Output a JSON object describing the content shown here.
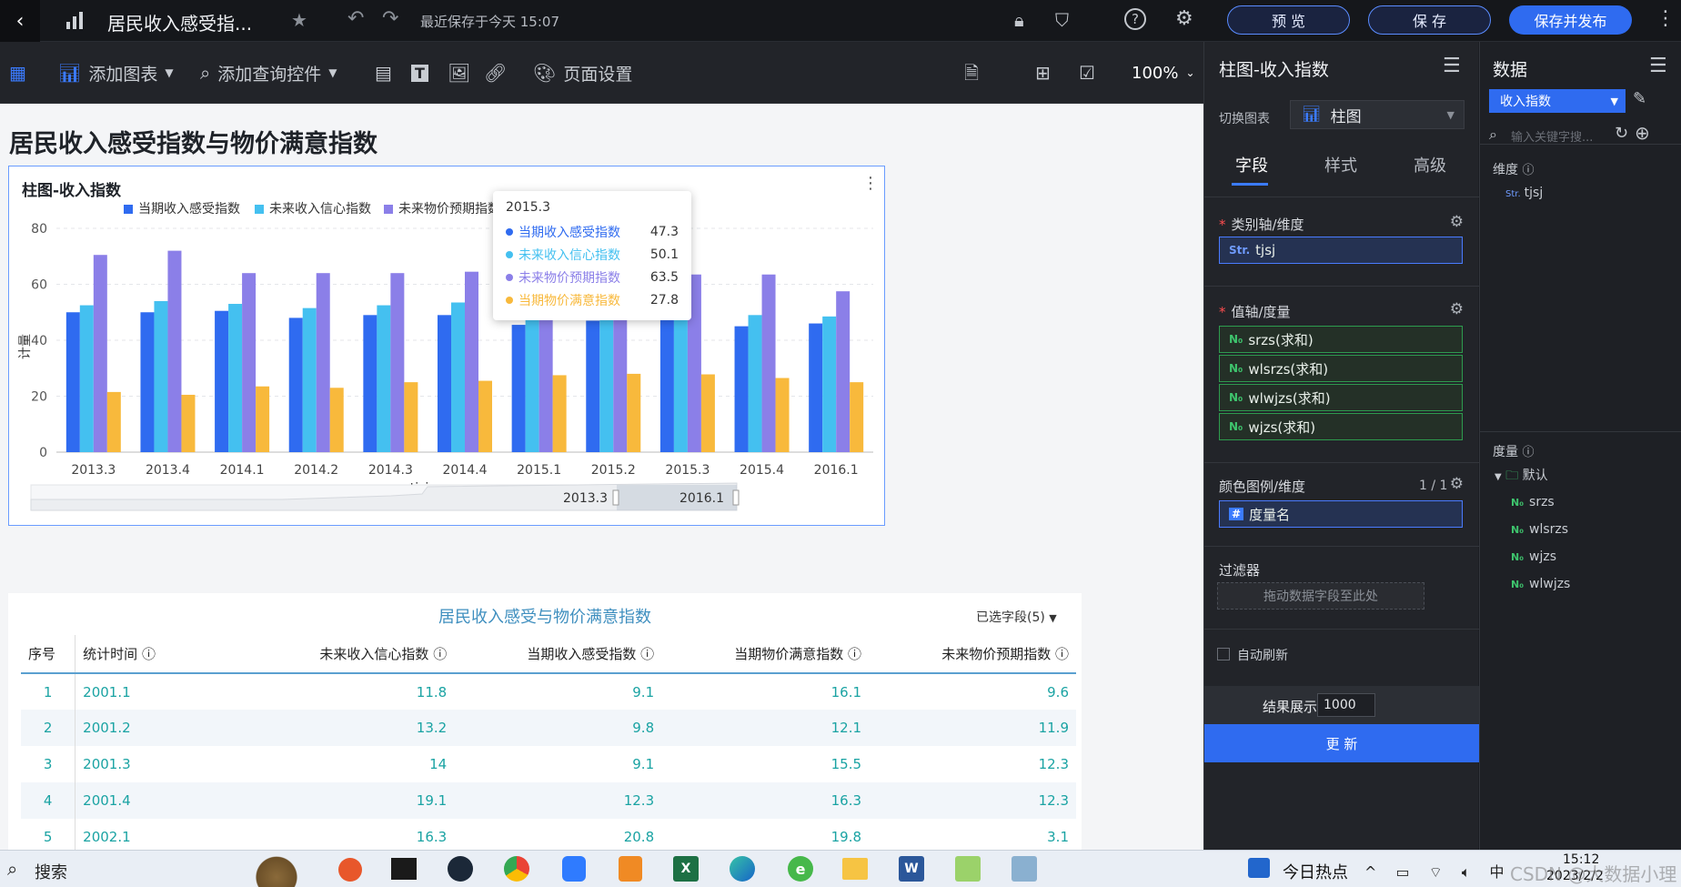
{
  "topbar": {
    "title": "居民收入感受指...",
    "save_status": "最近保存于今天 15:07",
    "preview": "预 览",
    "save": "保 存",
    "save_publish": "保存并发布"
  },
  "toolbar": {
    "add_chart": "添加图表",
    "add_query": "添加查询控件",
    "page_settings": "页面设置",
    "zoom": "100%"
  },
  "page": {
    "title": "居民收入感受指数与物价满意指数"
  },
  "chart_card": {
    "title": "柱图-收入指数",
    "x_axis_label": "tjsj",
    "y_axis_label": "计量",
    "slider_start": "2013.3",
    "slider_end": "2016.1"
  },
  "tooltip": {
    "title": "2015.3",
    "rows": [
      {
        "name": "当期收入感受指数",
        "value": "47.3",
        "color": "#2f6bf0"
      },
      {
        "name": "未来收入信心指数",
        "value": "50.1",
        "color": "#44c0f0"
      },
      {
        "name": "未来物价预期指数",
        "value": "63.5",
        "color": "#8b7fe8"
      },
      {
        "name": "当期物价满意指数",
        "value": "27.8",
        "color": "#f8b93c"
      }
    ]
  },
  "chart_data": {
    "type": "bar",
    "categories": [
      "2013.3",
      "2013.4",
      "2014.1",
      "2014.2",
      "2014.3",
      "2014.4",
      "2015.1",
      "2015.2",
      "2015.3",
      "2015.4",
      "2016.1"
    ],
    "series": [
      {
        "name": "当期收入感受指数",
        "color": "#2f6bf0",
        "values": [
          50,
          50,
          50.5,
          48,
          49,
          49,
          45.5,
          47,
          47.3,
          45,
          46
        ]
      },
      {
        "name": "未来收入信心指数",
        "color": "#44c0f0",
        "values": [
          52.5,
          54,
          53,
          51.5,
          52.5,
          53.5,
          49,
          49.5,
          50.1,
          49,
          48.5
        ]
      },
      {
        "name": "未来物价预期指数",
        "color": "#8b7fe8",
        "values": [
          70.5,
          72,
          64,
          64,
          64,
          64.5,
          63,
          63.5,
          63.5,
          63.5,
          57.5
        ]
      },
      {
        "name": "当期物价满意指数",
        "color": "#f8b93c",
        "values": [
          21.5,
          20.5,
          23.5,
          23,
          25,
          25.5,
          27.5,
          28,
          27.8,
          26.5,
          25
        ]
      }
    ],
    "ylim": [
      0,
      80
    ],
    "yticks": [
      "0",
      "20",
      "40",
      "60",
      "80"
    ],
    "xlabel": "tjsj",
    "ylabel": "计量"
  },
  "table": {
    "title": "居民收入感受与物价满意指数",
    "selected_fields": "已选字段(5)",
    "headers": [
      "序号",
      "统计时间",
      "未来收入信心指数",
      "当期收入感受指数",
      "当期物价满意指数",
      "未来物价预期指数"
    ],
    "rows": [
      [
        "1",
        "2001.1",
        "11.8",
        "9.1",
        "16.1",
        "9.6"
      ],
      [
        "2",
        "2001.2",
        "13.2",
        "9.8",
        "12.1",
        "11.9"
      ],
      [
        "3",
        "2001.3",
        "14",
        "9.1",
        "15.5",
        "12.3"
      ],
      [
        "4",
        "2001.4",
        "19.1",
        "12.3",
        "16.3",
        "12.3"
      ],
      [
        "5",
        "2002.1",
        "16.3",
        "20.8",
        "19.8",
        "3.1"
      ]
    ]
  },
  "panel1": {
    "title": "柱图-收入指数",
    "switch_chart_label": "切换图表",
    "chart_type": "柱图",
    "tabs": [
      "字段",
      "样式",
      "高级"
    ],
    "category_axis": "类别轴/维度",
    "category_field": "tjsj",
    "value_axis": "值轴/度量",
    "value_fields": [
      "srzs(求和)",
      "wlsrzs(求和)",
      "wlwjzs(求和)",
      "wjzs(求和)"
    ],
    "color_legend": "颜色图例/维度",
    "color_legend_count": "1 / 1",
    "color_field": "度量名",
    "filter": "过滤器",
    "filter_placeholder": "拖动数据字段至此处",
    "auto_refresh": "自动刷新",
    "result_label": "结果展示",
    "result_value": "1000",
    "update": "更 新"
  },
  "panel2": {
    "title": "数据",
    "dataset": "收入指数",
    "search_placeholder": "输入关键字搜...",
    "dimension_label": "维度",
    "dimension_fields": [
      "tjsj"
    ],
    "measure_label": "度量",
    "folder": "默认",
    "measure_fields": [
      "srzs",
      "wlsrzs",
      "wjzs",
      "wlwjzs"
    ]
  },
  "taskbar": {
    "search": "搜索",
    "hot": "今日热点",
    "time": "15:12",
    "date": "2023/2/2",
    "watermark": "CSDN @大数据小理"
  }
}
